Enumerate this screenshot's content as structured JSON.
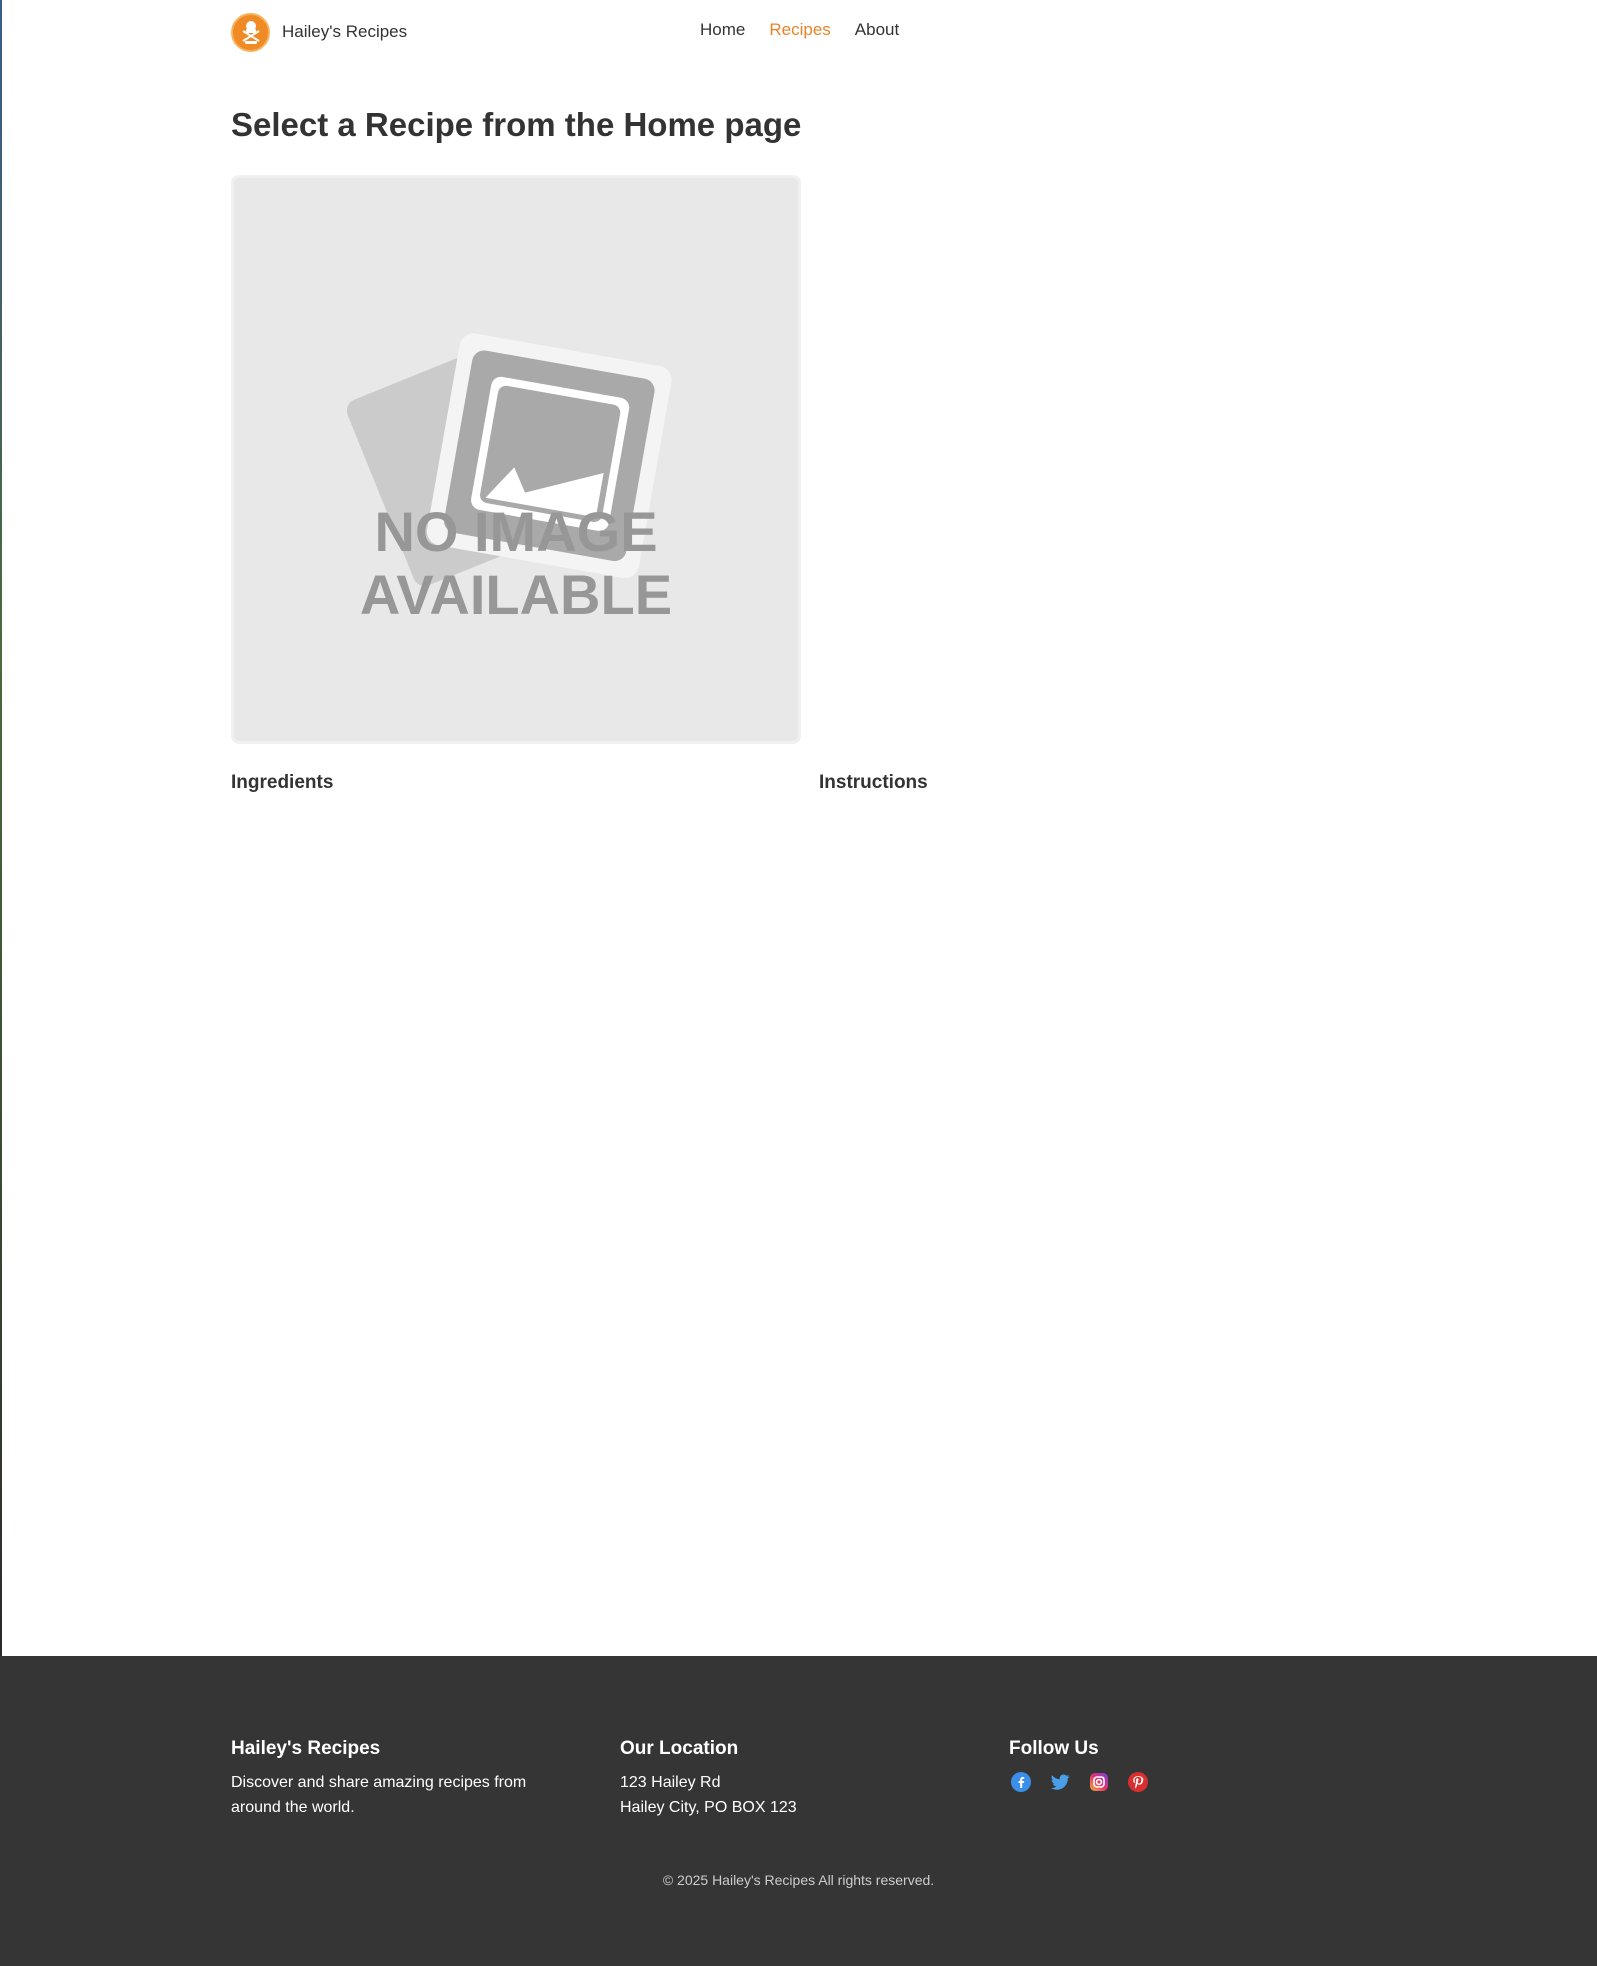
{
  "header": {
    "brand_name": "Hailey's Recipes",
    "nav": [
      {
        "label": "Home",
        "active": false
      },
      {
        "label": "Recipes",
        "active": true
      },
      {
        "label": "About",
        "active": false
      }
    ],
    "accent_color": "#e8832a"
  },
  "main": {
    "title": "Select a Recipe from the Home page",
    "image_placeholder": {
      "line1": "NO IMAGE",
      "line2": "AVAILABLE"
    },
    "ingredients_heading": "Ingredients",
    "instructions_heading": "Instructions"
  },
  "footer": {
    "about": {
      "heading": "Hailey's Recipes",
      "text": "Discover and share amazing recipes from around the world."
    },
    "location": {
      "heading": "Our Location",
      "line1": "123 Hailey Rd",
      "line2": "Hailey City, PO BOX 123"
    },
    "follow": {
      "heading": "Follow Us",
      "icons": [
        "facebook-icon",
        "twitter-icon",
        "instagram-icon",
        "pinterest-icon"
      ]
    },
    "copyright": "© 2025 Hailey's Recipes All rights reserved.",
    "background_color": "#353535"
  }
}
